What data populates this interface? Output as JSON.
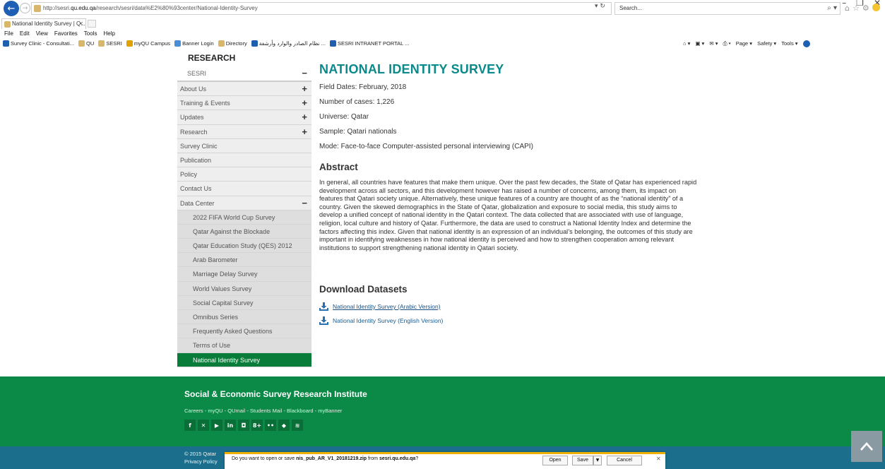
{
  "browser": {
    "url_prefix": "http://sesri.",
    "url_host": "qu.edu.qa",
    "url_path": "/research/sesri/data%E2%80%93center/National-Identity-Survey",
    "search_placeholder": "Search...",
    "tab_title": "National Identity Survey | Q...",
    "menu": [
      "File",
      "Edit",
      "View",
      "Favorites",
      "Tools",
      "Help"
    ],
    "favorites": [
      {
        "label": "Survey Clinic - Consultati...",
        "icon": "sesri-icon",
        "color": "#1f5fae"
      },
      {
        "label": "QU",
        "icon": "qu-icon",
        "color": "#d9b76a"
      },
      {
        "label": "SESRI",
        "icon": "qu-icon",
        "color": "#d9b76a"
      },
      {
        "label": "myQU Campus",
        "icon": "myqu-icon",
        "color": "#e0a000"
      },
      {
        "label": "Banner Login",
        "icon": "ie-icon",
        "color": "#4a8fd6"
      },
      {
        "label": "Directory",
        "icon": "qu-icon",
        "color": "#d9b76a"
      },
      {
        "label": "نظام الصادر والوارد وأرشفة ...",
        "icon": "sesri-icon",
        "color": "#1f5fae"
      },
      {
        "label": "SESRI INTRANET PORTAL ...",
        "icon": "sesri-icon",
        "color": "#1f5fae"
      }
    ],
    "commands": [
      "Page ▾",
      "Safety ▾",
      "Tools ▾"
    ]
  },
  "sidebar": {
    "heading": "RESEARCH",
    "group": "SESRI",
    "items": [
      {
        "label": "About Us",
        "expand": "+",
        "sub": false,
        "active": false
      },
      {
        "label": "Training & Events",
        "expand": "+",
        "sub": false,
        "active": false
      },
      {
        "label": "Updates",
        "expand": "+",
        "sub": false,
        "active": false
      },
      {
        "label": "Research",
        "expand": "+",
        "sub": false,
        "active": false
      },
      {
        "label": "Survey Clinic",
        "expand": "",
        "sub": false,
        "active": false
      },
      {
        "label": "Publication",
        "expand": "",
        "sub": false,
        "active": false
      },
      {
        "label": "Policy",
        "expand": "",
        "sub": false,
        "active": false
      },
      {
        "label": "Contact Us",
        "expand": "",
        "sub": false,
        "active": false
      },
      {
        "label": "Data Center",
        "expand": "−",
        "sub": false,
        "active": false
      },
      {
        "label": "2022 FIFA World Cup Survey",
        "expand": "",
        "sub": true,
        "active": false
      },
      {
        "label": "Qatar Against the Blockade",
        "expand": "",
        "sub": true,
        "active": false
      },
      {
        "label": "Qatar Education Study (QES) 2012",
        "expand": "",
        "sub": true,
        "active": false
      },
      {
        "label": "Arab Barometer",
        "expand": "",
        "sub": true,
        "active": false
      },
      {
        "label": "Marriage Delay Survey",
        "expand": "",
        "sub": true,
        "active": false
      },
      {
        "label": "World Values Survey",
        "expand": "",
        "sub": true,
        "active": false
      },
      {
        "label": "Social Capital Survey",
        "expand": "",
        "sub": true,
        "active": false
      },
      {
        "label": "Omnibus Series",
        "expand": "",
        "sub": true,
        "active": false
      },
      {
        "label": "Frequently Asked Questions",
        "expand": "",
        "sub": true,
        "active": false
      },
      {
        "label": "Terms of Use",
        "expand": "",
        "sub": true,
        "active": false
      },
      {
        "label": "National Identity Survey",
        "expand": "",
        "sub": true,
        "active": true
      }
    ]
  },
  "main": {
    "title": "NATIONAL IDENTITY SURVEY",
    "meta": [
      "Field Dates: February, 2018",
      "Number of cases: 1,226",
      "Universe: Qatar",
      "Sample: Qatari nationals",
      "Mode: Face-to-face Computer-assisted personal interviewing (CAPI)"
    ],
    "abstract_heading": "Abstract",
    "abstract": "In general, all countries have features that make them unique. Over the past few decades, the State of Qatar has experienced rapid development across all sectors, and this development however has raised a number of concerns, among them, its impact on features that Qatari society unique. Alternatively, these unique features of a country are thought of as the “national identity” of a country. Given the skewed demographics in the State of Qatar, globalization and exposure to social media, this study aims to develop a unified concept of national identity in the Qatari context. The data collected that are associated with use of language, religion, local culture and history of Qatar. Furthermore, the data are used to construct a National Identity Index and determine the factors affecting this index. Given that national identity is an expression of an individual’s belonging, the outcomes of this study are important in identifying weaknesses in how national identity is perceived and how to strengthen cooperation among relevant institutions to support strengthening national identity in Qatari society.",
    "downloads_heading": "Download Datasets",
    "downloads": [
      "National Identity Survey (Arabic Version)",
      "National Identity Survey (English Version)"
    ]
  },
  "footer": {
    "title": "Social & Economic Survey Research Institute",
    "links": "Careers - myQU - QUmail - Students Mail - Blackboard - myBanner",
    "socials": [
      {
        "glyph": "f",
        "icon": "facebook-icon"
      },
      {
        "glyph": "✕",
        "icon": "twitter-icon"
      },
      {
        "glyph": "▶",
        "icon": "youtube-icon"
      },
      {
        "glyph": "in",
        "icon": "linkedin-icon"
      },
      {
        "glyph": "◘",
        "icon": "instagram-icon"
      },
      {
        "glyph": "8+",
        "icon": "googleplus-icon"
      },
      {
        "glyph": "••",
        "icon": "flickr-icon"
      },
      {
        "glyph": "◆",
        "icon": "dropbox-icon"
      },
      {
        "glyph": "≋",
        "icon": "rss-icon"
      }
    ],
    "copyright": "© 2015 Qatar",
    "privacy": "Privacy Policy"
  },
  "download_prompt": {
    "prefix": "Do you want to open or save ",
    "filename": "nis_pub_AR_V1_20181219.zip",
    "middle": " from ",
    "host": "sesri.qu.edu.qa",
    "suffix": "?",
    "open": "Open",
    "save": "Save",
    "cancel": "Cancel"
  },
  "colors": {
    "title_teal": "#0a8a8a",
    "active_green": "#0a7c3a",
    "footer_green": "#0a8a46",
    "bottom_blue": "#1c6f8c",
    "notification_accent": "#f0b000"
  }
}
